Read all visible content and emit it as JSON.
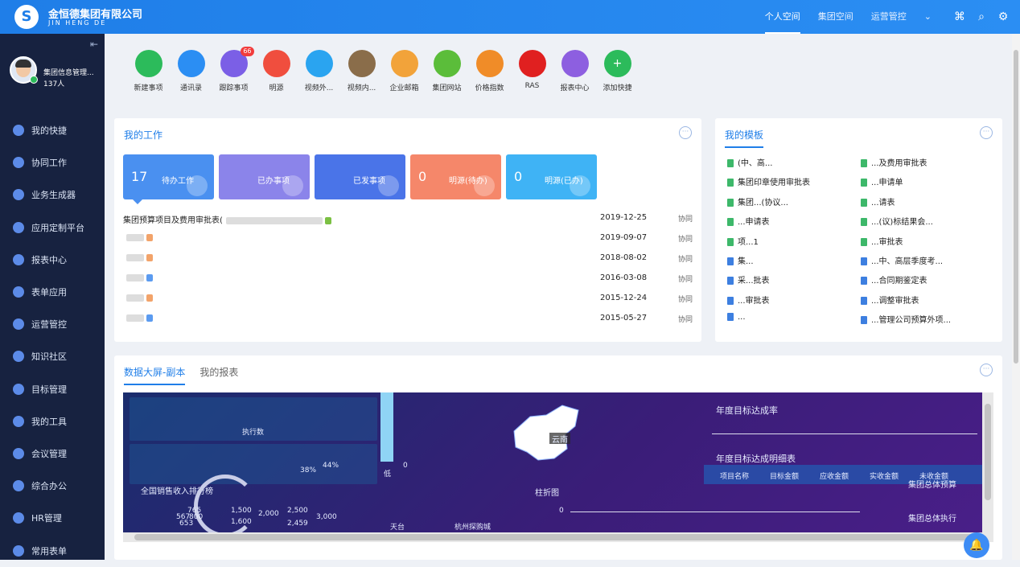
{
  "header": {
    "company_name": "金恒德集团有限公司",
    "company_en": "JIN HENG DE",
    "nav": [
      "个人空间",
      "集团空间",
      "运营管控"
    ],
    "accent": "#1f7ee8"
  },
  "sidebar": {
    "user_name": "集团信息管理...",
    "user_count": "137人",
    "items": [
      {
        "label": "我的快捷",
        "icon": "lightning-icon"
      },
      {
        "label": "协同工作",
        "icon": "flow-icon"
      },
      {
        "label": "业务生成器",
        "icon": "cube-icon"
      },
      {
        "label": "应用定制平台",
        "icon": "app-icon"
      },
      {
        "label": "报表中心",
        "icon": "bar-chart-icon"
      },
      {
        "label": "表单应用",
        "icon": "form-icon"
      },
      {
        "label": "运营管控",
        "icon": "control-icon"
      },
      {
        "label": "知识社区",
        "icon": "graduation-icon"
      },
      {
        "label": "目标管理",
        "icon": "target-icon"
      },
      {
        "label": "我的工具",
        "icon": "toolbox-icon"
      },
      {
        "label": "会议管理",
        "icon": "people-icon"
      },
      {
        "label": "综合办公",
        "icon": "office-icon"
      },
      {
        "label": "HR管理",
        "icon": "hr-icon"
      },
      {
        "label": "常用表单",
        "icon": "document-icon"
      }
    ]
  },
  "quick_links": [
    {
      "label": "新建事项",
      "color": "#2cbb5b",
      "icon": "new-item-icon"
    },
    {
      "label": "通讯录",
      "color": "#2b8ef3",
      "icon": "contacts-icon"
    },
    {
      "label": "跟踪事项",
      "color": "#7b5fe6",
      "icon": "track-icon",
      "badge": "66"
    },
    {
      "label": "明源",
      "color": "#f04e3e",
      "icon": "mingyuan-icon"
    },
    {
      "label": "视频外...",
      "color": "#2aa4f0",
      "icon": "video-out-icon"
    },
    {
      "label": "视频内...",
      "color": "#8a6d4a",
      "icon": "video-in-icon"
    },
    {
      "label": "企业邮箱",
      "color": "#f2a33a",
      "icon": "mail-icon"
    },
    {
      "label": "集团网站",
      "color": "#5bbd3a",
      "icon": "website-icon"
    },
    {
      "label": "价格指数",
      "color": "#f08c28",
      "icon": "price-index-icon"
    },
    {
      "label": "RAS",
      "color": "#e02020",
      "icon": "ras-icon"
    },
    {
      "label": "报表中心",
      "color": "#8d5fe0",
      "icon": "report-icon"
    },
    {
      "label": "添加快捷",
      "color": "#2cbb5b",
      "icon": "plus-icon"
    }
  ],
  "my_work": {
    "title": "我的工作",
    "tiles": [
      {
        "num": "17",
        "label": "待办工作",
        "color": "#4a90f0"
      },
      {
        "num": "",
        "label": "已办事项",
        "color": "#8b84ea"
      },
      {
        "num": "",
        "label": "已发事项",
        "color": "#4a74e8"
      },
      {
        "num": "0",
        "label": "明源(待办)",
        "color": "#f5876a"
      },
      {
        "num": "0",
        "label": "明源(已办)",
        "color": "#3fb3f5"
      }
    ],
    "rows": [
      {
        "title": "集团预算项目及费用审批表(",
        "date": "2019-12-25",
        "status": "协同"
      },
      {
        "title": "",
        "date": "2019-09-07",
        "status": "协同"
      },
      {
        "title": "",
        "date": "2018-08-02",
        "status": "协同"
      },
      {
        "title": "",
        "date": "2016-03-08",
        "status": "协同"
      },
      {
        "title": "",
        "date": "2015-12-24",
        "status": "协同"
      },
      {
        "title": "",
        "date": "2015-05-27",
        "status": "协同"
      }
    ]
  },
  "templates": {
    "title": "我的模板",
    "left": [
      "(中、高...",
      "集团印章使用审批表",
      "集团...(协议...",
      "...申请表",
      "项...1",
      "集...",
      "采...批表",
      "...审批表",
      "..."
    ],
    "right": [
      "...及费用审批表",
      "...申请单",
      "...请表",
      "...(议)标结果会...",
      "...审批表",
      "...中、高层季度考...",
      "...合同期鉴定表",
      "...调整审批表",
      "...管理公司预算外项..."
    ]
  },
  "reports": {
    "tabs": [
      "数据大屏-副本",
      "我的报表"
    ],
    "dashboard": {
      "exec_count_label": "执行数",
      "pct1": "44%",
      "pct2": "38%",
      "low_label": "低",
      "zero": "0",
      "map_label": "云南",
      "annual_rate_title": "年度目标达成率",
      "annual_detail_title": "年度目标达成明细表",
      "table_headers": [
        "项目名称",
        "目标金额",
        "应收金额",
        "实收金额",
        "未收金额"
      ],
      "sales_rank_title": "全国销售收入排行榜",
      "sales_values": [
        "765",
        "1,500",
        "2,000",
        "2,500",
        "3,000",
        "567",
        "800",
        "1,600",
        "2,459",
        "653"
      ],
      "city1": "天台",
      "city2": "杭州探购城",
      "bar_line_title": "柱折图",
      "bar_line_zero": "0",
      "budget_title": "集团总体预算",
      "exec_title": "集团总体执行"
    }
  }
}
